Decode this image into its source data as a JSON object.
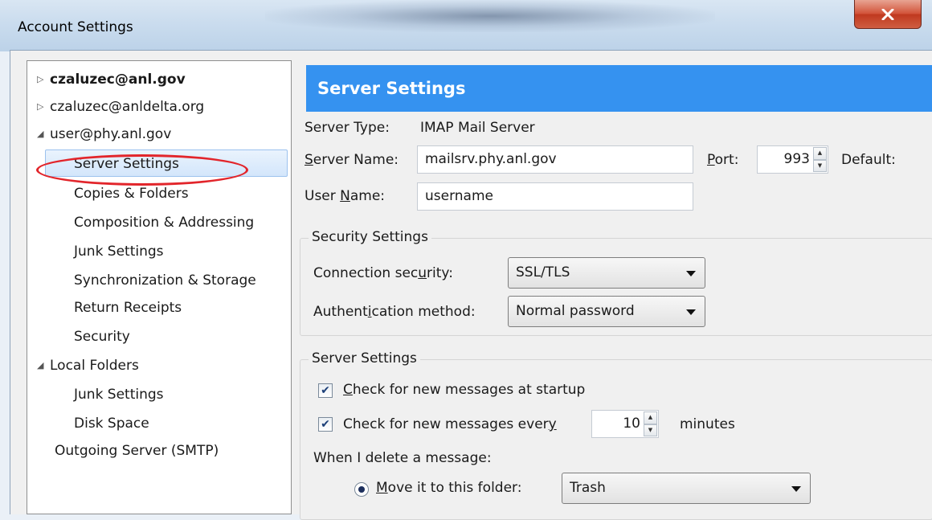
{
  "window": {
    "title": "Account Settings"
  },
  "tree": {
    "items": [
      {
        "label": "czaluzec@anl.gov"
      },
      {
        "label": "czaluzec@anldelta.org"
      },
      {
        "label": "user@phy.anl.gov"
      },
      {
        "label": "Server Settings"
      },
      {
        "label": "Copies & Folders"
      },
      {
        "label": "Composition & Addressing"
      },
      {
        "label": "Junk Settings"
      },
      {
        "label": "Synchronization & Storage"
      },
      {
        "label": "Return Receipts"
      },
      {
        "label": "Security"
      },
      {
        "label": "Local Folders"
      },
      {
        "label": "Junk Settings"
      },
      {
        "label": "Disk Space"
      },
      {
        "label": "Outgoing Server (SMTP)"
      }
    ]
  },
  "panel": {
    "header": "Server Settings",
    "server_type_label": "Server Type:",
    "server_type_value": "IMAP Mail Server",
    "server_name_label": "Server Name:",
    "server_name_value": "mailsrv.phy.anl.gov",
    "port_label": "Port:",
    "port_value": "993",
    "default_label": "Default:",
    "user_name_label": "User Name:",
    "user_name_value": "username"
  },
  "security": {
    "group_title": "Security Settings",
    "connection_label": "Connection security:",
    "connection_value": "SSL/TLS",
    "auth_label": "Authentication method:",
    "auth_value": "Normal password"
  },
  "server_settings": {
    "group_title": "Server Settings",
    "check_startup_label": "Check for new messages at startup",
    "check_startup_checked": true,
    "check_every_label": "Check for new messages every",
    "check_every_checked": true,
    "check_every_minutes": "10",
    "minutes_label": "minutes",
    "delete_label": "When I delete a message:",
    "move_label": "Move it to this folder:",
    "move_folder": "Trash"
  }
}
